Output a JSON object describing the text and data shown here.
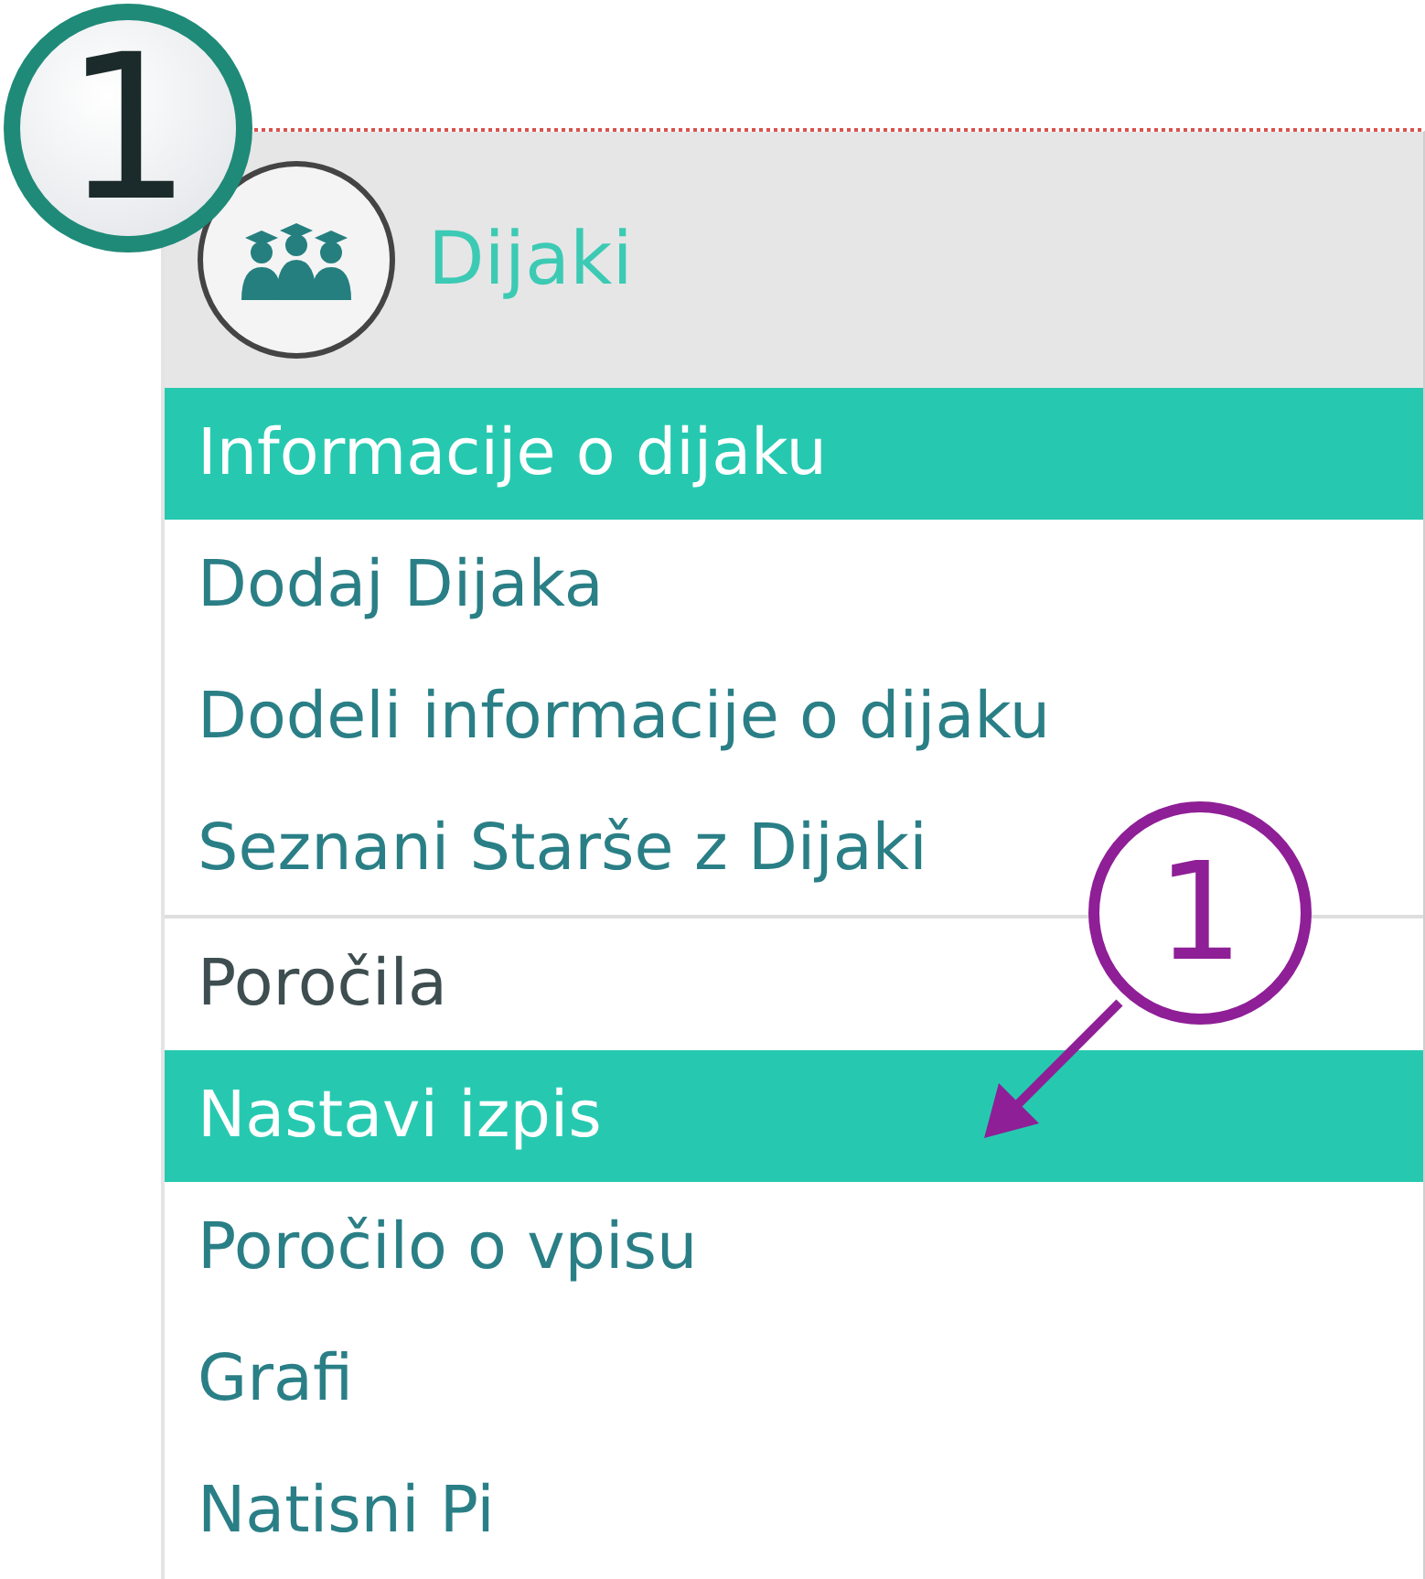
{
  "menu": {
    "title": "Dijaki",
    "sections": [
      {
        "items": [
          {
            "kind": "link",
            "label": "Informacije o dijaku",
            "selected": true
          },
          {
            "kind": "link",
            "label": "Dodaj Dijaka",
            "selected": false
          },
          {
            "kind": "link",
            "label": "Dodeli informacije o dijaku",
            "selected": false
          },
          {
            "kind": "link",
            "label": "Seznani Starše z Dijaki",
            "selected": false
          }
        ]
      },
      {
        "items": [
          {
            "kind": "heading",
            "label": "Poročila",
            "selected": false
          },
          {
            "kind": "link",
            "label": "Nastavi izpis",
            "selected": true
          },
          {
            "kind": "link",
            "label": "Poročilo o vpisu",
            "selected": false
          },
          {
            "kind": "link",
            "label": "Grafi",
            "selected": false
          },
          {
            "kind": "link",
            "label": "Natisni Pi",
            "selected": false
          }
        ]
      }
    ]
  },
  "step_badge": {
    "label": "1"
  },
  "arrow_callout": {
    "label": "1"
  }
}
